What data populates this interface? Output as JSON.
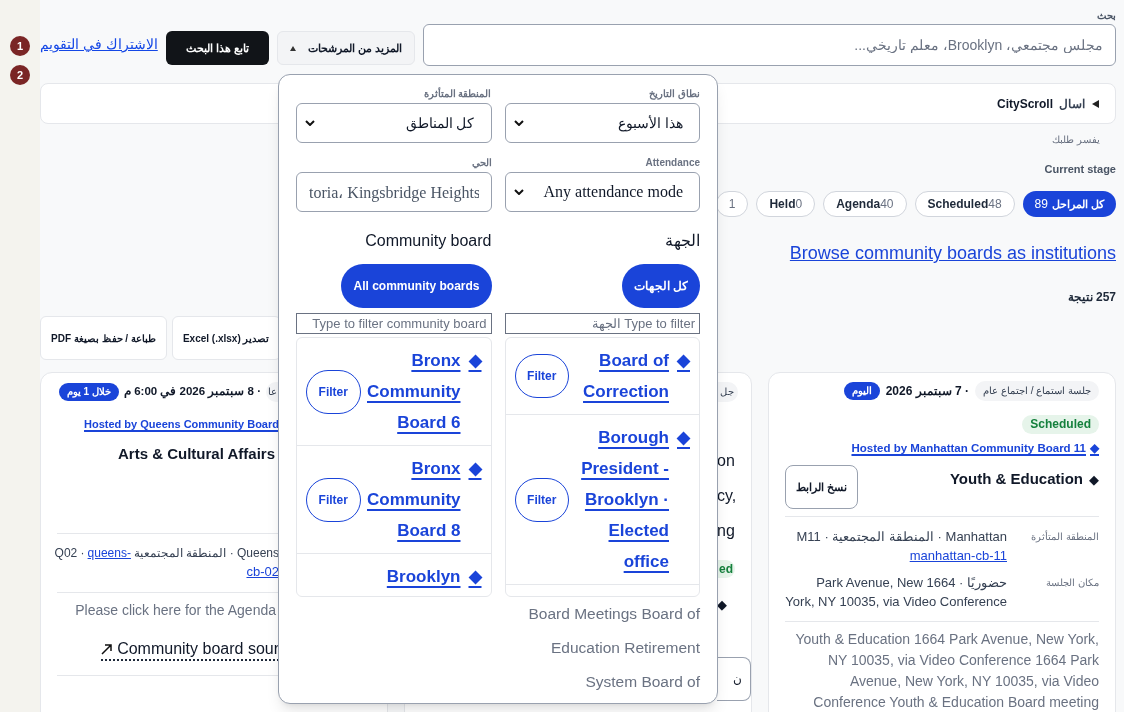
{
  "gutter": {
    "markers": [
      "1",
      "2"
    ]
  },
  "search": {
    "label": "بحث",
    "placeholder": "مجلس مجتمعي، Brooklyn، معلم تاريخي..."
  },
  "more_filters": {
    "label": "المزيد من المرشحات",
    "expanded": true
  },
  "follow_button": "تابع هذا البحث",
  "calendar_link": "الاشتراك في التقويم",
  "assistant": {
    "label": "اسال",
    "brand": "CityScroll",
    "expanded": false
  },
  "assistant_hint": "يفسر طلبك",
  "stages": {
    "label": "Current stage",
    "items": [
      {
        "label": "كل المراحل",
        "count": "89",
        "selected": true
      },
      {
        "label": "Scheduled",
        "count": "48",
        "selected": false
      },
      {
        "label": "Agenda",
        "count": "40",
        "selected": false
      },
      {
        "label": "Held",
        "count": "0",
        "selected": false
      },
      {
        "count": "1",
        "selected": false
      }
    ]
  },
  "browse_link": "Browse community boards as institutions",
  "result_count": "257 نتيجة",
  "exports": [
    "تصدير Excel (.xlsx)",
    "طباعة / حفظ بصيغة PDF"
  ],
  "cards": [
    {
      "kind": "full",
      "type_chip": "جلسة استماع / اجتماع عام",
      "date": "· 7 سبتمبر 2026",
      "when_badge": "اليوم",
      "stage": "Scheduled",
      "host": "Hosted by Manhattan Community Board 11",
      "host_marker": "◆",
      "title": "Youth & Education",
      "title_marker": "◆",
      "copy_button": "نسخ الرابط",
      "details": [
        {
          "label": "المنطقة المتأثرة",
          "value": "Manhattan · المنطقة المجتمعية · M11",
          "link": "manhattan-cb-11"
        },
        {
          "label": "مكان الجلسة",
          "value": "حضوريًا · 1664 Park Avenue, New York, NY 10035, via Video Conference"
        }
      ],
      "description": "Youth & Education 1664 Park Avenue, New York, NY 10035, via Video Conference 1664 Park Avenue, New York, NY 10035, via Video Conference Youth & Education Board meeting"
    },
    {
      "kind": "strip",
      "type_chip": "جل",
      "lines": [
        "on",
        "cy,",
        "ng"
      ],
      "stage": "ed",
      "title_marker": "◆",
      "copy_button": "ن"
    },
    {
      "kind": "clipped",
      "type_chip": "عا",
      "date": "· 8 سبتمبر 2026 في 6:00 م",
      "when_badge": "خلال 1 يوم",
      "host": "Hosted by Queens Community Board",
      "title": "Arts & Cultural Affairs",
      "region": {
        "code": "Q02 ·",
        "link": "queens-",
        "area": "المنطقة المجتمعية · Queens",
        "link_rest": "cb-02"
      },
      "agenda_note": "Please click here for the Agenda",
      "source_link": "Community board sour"
    }
  ],
  "filters_panel": {
    "date_range": {
      "label": "نطاق التاريخ",
      "value": "هذا الأسبوع"
    },
    "area": {
      "label": "المنطقة المتأثرة",
      "value": "كل المناطق"
    },
    "attendance": {
      "label": "Attendance",
      "value": "Any attendance mode"
    },
    "neighborhood": {
      "label": "الحي",
      "value": "toria، Kingsbridge Heights"
    },
    "body": {
      "heading": "الجهة",
      "all_button": "كل الجهات",
      "filter_placeholder": "Type to filter الجهة",
      "items": [
        {
          "name": "Board of Correction",
          "marker": "◆",
          "filter": "Filter"
        },
        {
          "name": "Borough President - Brooklyn · Elected office",
          "marker": "◆",
          "filter": "Filter"
        }
      ],
      "overflow_text": "Board Meetings Board of Education Retirement System Board of"
    },
    "community_board": {
      "heading": "Community board",
      "all_button": "All community boards",
      "filter_placeholder": "Type to filter community board",
      "items": [
        {
          "name": "Bronx Community Board 6",
          "marker": "◆",
          "filter": "Filter"
        },
        {
          "name": "Bronx Community Board 8",
          "marker": "◆",
          "filter": "Filter"
        },
        {
          "name": "Brooklyn",
          "marker": "◆"
        }
      ]
    }
  }
}
